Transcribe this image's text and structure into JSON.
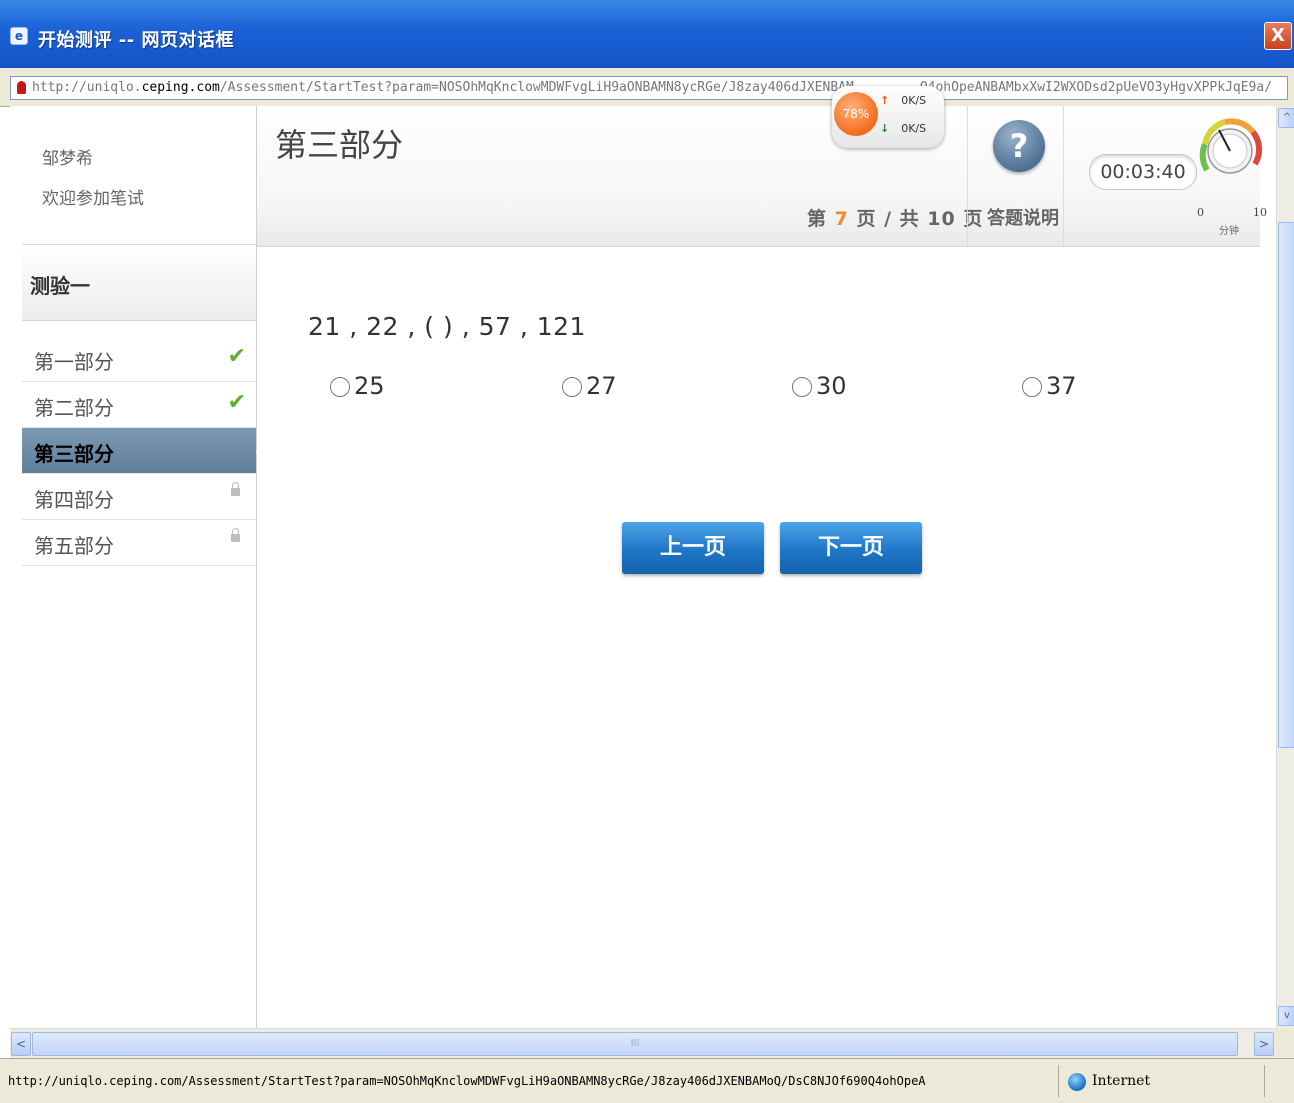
{
  "window": {
    "title": "开始测评 -- 网页对话框",
    "close_label": "X"
  },
  "address": {
    "url_prefix": "http://uniqlo.",
    "url_host": "ceping.com",
    "url_rest": "/Assessment/StartTest?param=NOSOhMqKnclowMDWFvgLiH9aONBAMN8ycRGe/J8zay406dJXENBAM",
    "url_tail": "Q4ohOpeANBAMbxXwI2WXODsd2pUeVO3yHgvXPPkJqE9a/"
  },
  "speed_widget": {
    "percent": "78%",
    "up_arrow": "↑",
    "up_rate": "0K/S",
    "down_arrow": "↓",
    "down_rate": "0K/S"
  },
  "user": {
    "name": "邹梦希",
    "welcome": "欢迎参加笔试"
  },
  "sidebar": {
    "test_name": "测验一",
    "sections": [
      {
        "label": "第一部分",
        "status": "completed"
      },
      {
        "label": "第二部分",
        "status": "completed"
      },
      {
        "label": "第三部分",
        "status": "active"
      },
      {
        "label": "第四部分",
        "status": "locked"
      },
      {
        "label": "第五部分",
        "status": "locked"
      }
    ],
    "check_glyph": "✔"
  },
  "header": {
    "part_title": "第三部分",
    "page_prefix": "第 ",
    "page_current": "7",
    "page_middle": " 页 / 共 ",
    "page_total": "10",
    "page_suffix": " 页",
    "help_glyph": "?",
    "help_label": "答题说明",
    "timer": "00:03:40",
    "gauge_min": "0",
    "gauge_max": "10",
    "gauge_unit": "分钟"
  },
  "question": {
    "text": "21 , 22 , ( ) , 57 , 121",
    "options": [
      "25",
      "27",
      "30",
      "37"
    ]
  },
  "navigation": {
    "prev_label": "上一页",
    "next_label": "下一页"
  },
  "scrollbars": {
    "up_arrow": "^",
    "down_arrow": "v",
    "left_arrow": "<",
    "right_arrow": ">",
    "grip": "III"
  },
  "status": {
    "url": "http://uniqlo.ceping.com/Assessment/StartTest?param=NOSOhMqKnclowMDWFvgLiH9aONBAMN8ycRGe/J8zay406dJXENBAMoQ/DsC8NJOf690Q4ohOpeA",
    "zone": "Internet"
  },
  "colors": {
    "titlebar": "#1c63d8",
    "accent_orange": "#f08a2a",
    "button_blue": "#1f76c6",
    "check_green": "#5cb030",
    "active_section": "#6f8ea9"
  }
}
